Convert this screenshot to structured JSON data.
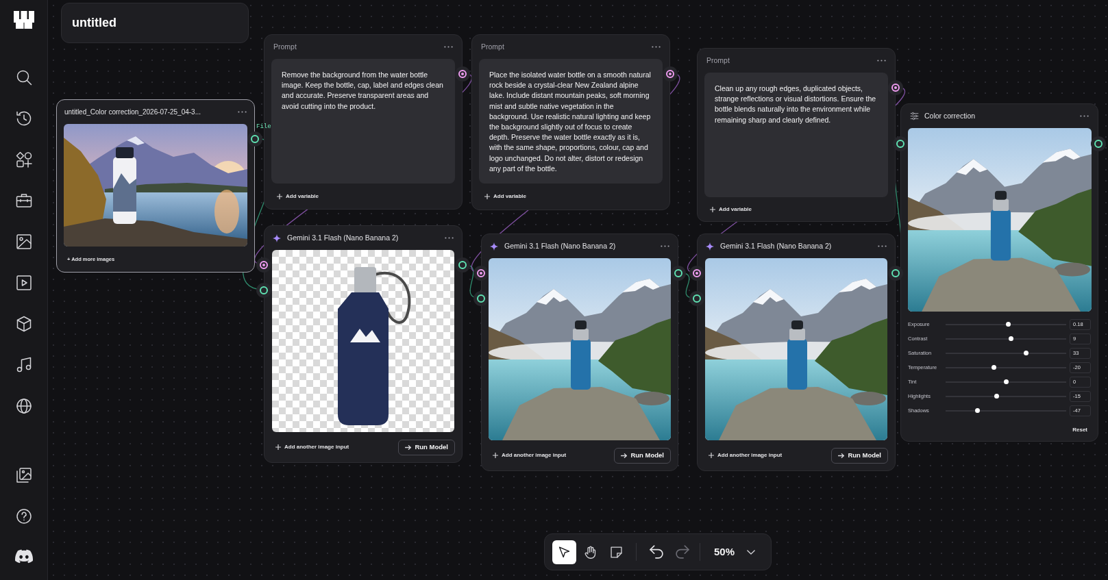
{
  "document": {
    "title": "untitled"
  },
  "nodes": [
    {
      "kind": "image",
      "selected": true,
      "title": "untitled_Color correction_2026-07-25_04-3...",
      "add_label": "+ Add more images",
      "port_label": "File"
    },
    {
      "kind": "prompt",
      "selected": false,
      "title": "Prompt",
      "text": "Remove the background from the water bottle image. Keep the bottle, cap, label and edges clean and accurate. Preserve transparent areas and avoid cutting into the product.",
      "add_label": "Add variable"
    },
    {
      "kind": "prompt",
      "selected": false,
      "title": "Prompt",
      "text": "Place the isolated water bottle on a smooth natural rock beside a crystal-clear New Zealand alpine lake. Include distant mountain peaks, soft morning mist and subtle native vegetation in the background. Use realistic natural lighting and keep the background slightly out of focus to create depth. Preserve the water bottle exactly as it is, with the same shape, proportions, colour, cap and logo unchanged. Do not alter, distort or redesign any part of the bottle.",
      "add_label": "Add variable"
    },
    {
      "kind": "prompt",
      "selected": false,
      "title": "Prompt",
      "text": "Clean up any rough edges, duplicated objects, strange reflections or visual distortions. Ensure the bottle blends naturally into the environment while remaining sharp and clearly defined.",
      "add_label": "Add variable"
    },
    {
      "kind": "model",
      "selected": false,
      "title": "Gemini 3.1 Flash (Nano Banana 2)",
      "add_label": "Add another image input",
      "button": "Run Model"
    },
    {
      "kind": "model",
      "selected": false,
      "title": "Gemini 3.1 Flash (Nano Banana 2)",
      "add_label": "Add another image input",
      "button": "Run Model"
    },
    {
      "kind": "model",
      "selected": false,
      "title": "Gemini 3.1 Flash (Nano Banana 2)",
      "add_label": "Add another image input",
      "button": "Run Model"
    },
    {
      "kind": "adjust",
      "selected": false,
      "title": "Color correction",
      "adjustments": [
        {
          "label": "Exposure",
          "level": 0.52,
          "value": "0.18"
        },
        {
          "label": "Contrast",
          "level": 0.545,
          "value": "9"
        },
        {
          "label": "Saturation",
          "level": 0.665,
          "value": "33"
        },
        {
          "label": "Temperature",
          "level": 0.4,
          "value": "-20"
        },
        {
          "label": "Tint",
          "level": 0.5,
          "value": "0"
        },
        {
          "label": "Highlights",
          "level": 0.425,
          "value": "-15"
        },
        {
          "label": "Shadows",
          "level": 0.265,
          "value": "-47"
        }
      ],
      "reset": "Reset"
    }
  ],
  "toolbar": {
    "tools": [
      {
        "kind": "select",
        "selected": true
      },
      {
        "kind": "hand",
        "selected": false
      },
      {
        "kind": "note",
        "selected": false
      }
    ],
    "history": [
      {
        "kind": "undo",
        "disabled": false
      },
      {
        "kind": "redo",
        "disabled": true
      }
    ],
    "zoom": "50%"
  }
}
